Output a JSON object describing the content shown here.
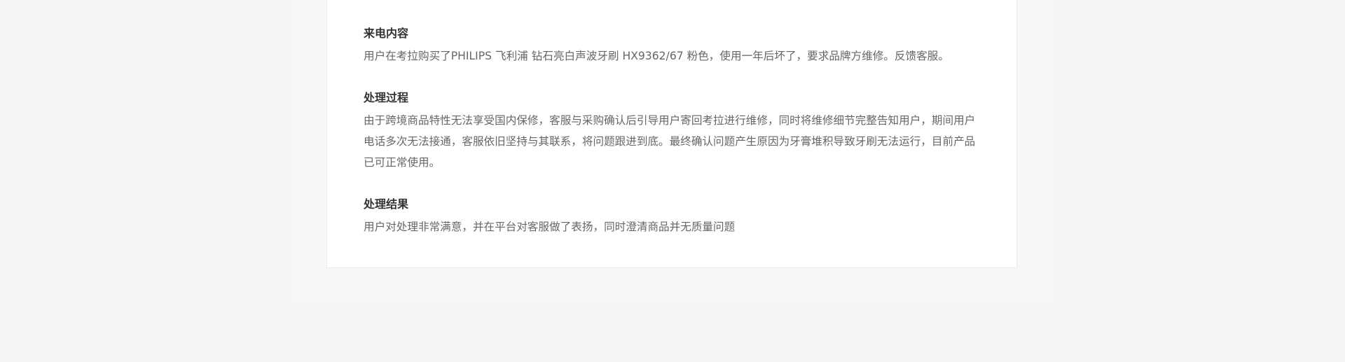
{
  "sections": [
    {
      "title": "来电内容",
      "body": "用户在考拉购买了PHILIPS 飞利浦 钻石亮白声波牙刷 HX9362/67 粉色，使用一年后坏了，要求品牌方维修。反馈客服。"
    },
    {
      "title": "处理过程",
      "body": "由于跨境商品特性无法享受国内保修，客服与采购确认后引导用户寄回考拉进行维修，同时将维修细节完整告知用户，期间用户电话多次无法接通，客服依旧坚持与其联系，将问题跟进到底。最终确认问题产生原因为牙膏堆积导致牙刷无法运行，目前产品已可正常使用。"
    },
    {
      "title": "处理结果",
      "body": "用户对处理非常满意，并在平台对客服做了表扬，同时澄清商品并无质量问题"
    }
  ]
}
